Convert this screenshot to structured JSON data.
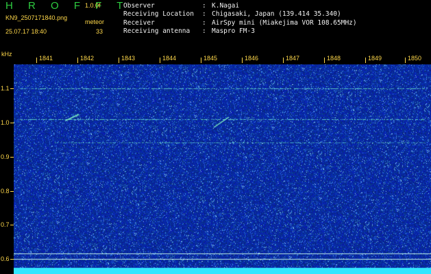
{
  "header": {
    "app_title": "H R O F F T",
    "version": "1.0.0f",
    "filename": "KN9_2507171840.png",
    "mode_label": "meteor",
    "datetime": "25.07.17 18:40",
    "count": "33"
  },
  "station_info": [
    {
      "key": "Observer",
      "sep": ":",
      "value": "K.Nagai"
    },
    {
      "key": "Receiving Location",
      "sep": ":",
      "value": "Chigasaki, Japan (139.414 35.340)"
    },
    {
      "key": "Receiver",
      "sep": ":",
      "value": "AirSpy mini (Miakejima VOR 108.65MHz)"
    },
    {
      "key": "Receiving antenna",
      "sep": ":",
      "value": "Maspro FM-3"
    }
  ],
  "axis": {
    "unit": "kHz",
    "minutes": [
      "1841",
      "1842",
      "1843",
      "1844",
      "1845",
      "1846",
      "1847",
      "1848",
      "1849",
      "1850"
    ],
    "freq_labels": [
      "1.1",
      "1.0",
      "0.9",
      "0.8",
      "0.7",
      "0.6"
    ]
  },
  "colors": {
    "background": "#000000",
    "label": "#ffd84a",
    "title": "#2ecc40",
    "noise": "#0a1f9e",
    "signal": "#33e0e0"
  }
}
